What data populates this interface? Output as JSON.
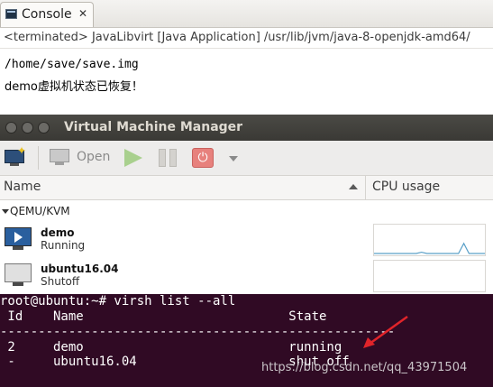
{
  "console": {
    "tab_title": "Console",
    "close_glyph": "✕",
    "header": "<terminated> JavaLibvirt [Java Application] /usr/lib/jvm/java-8-openjdk-amd64/",
    "lines": [
      "/home/save/save.img",
      "demo虚拟机状态已恢复！"
    ]
  },
  "vmm": {
    "title": "Virtual Machine Manager",
    "toolbar": {
      "open_label": "Open",
      "power_glyph": "⏻",
      "icons": [
        "new-vm-icon",
        "open-icon",
        "run-icon",
        "pause-icon",
        "shutdown-icon",
        "dropdown-icon"
      ]
    },
    "columns": {
      "name": "Name",
      "cpu": "CPU usage"
    },
    "group": "QEMU/KVM",
    "vms": [
      {
        "name": "demo",
        "status": "Running",
        "cpu_activity": [
          0,
          0,
          0,
          0,
          0,
          0,
          0,
          0,
          0,
          0.1,
          0,
          0,
          0,
          0,
          0,
          0,
          0,
          0.8,
          0,
          0,
          0,
          0
        ]
      },
      {
        "name": "ubuntu16.04",
        "status": "Shutoff",
        "cpu_activity": []
      }
    ]
  },
  "terminal": {
    "prompt": "root@ubuntu:~# virsh list --all",
    "header": " Id    Name                           State",
    "divider": "----------------------------------------------------",
    "rows": [
      " 2     demo                           running",
      " -     ubuntu16.04                    shut off"
    ],
    "colors": {
      "background": "#300a24",
      "arrow": "#e0242a"
    }
  },
  "watermark": "https://blog.csdn.net/qq_43971504"
}
